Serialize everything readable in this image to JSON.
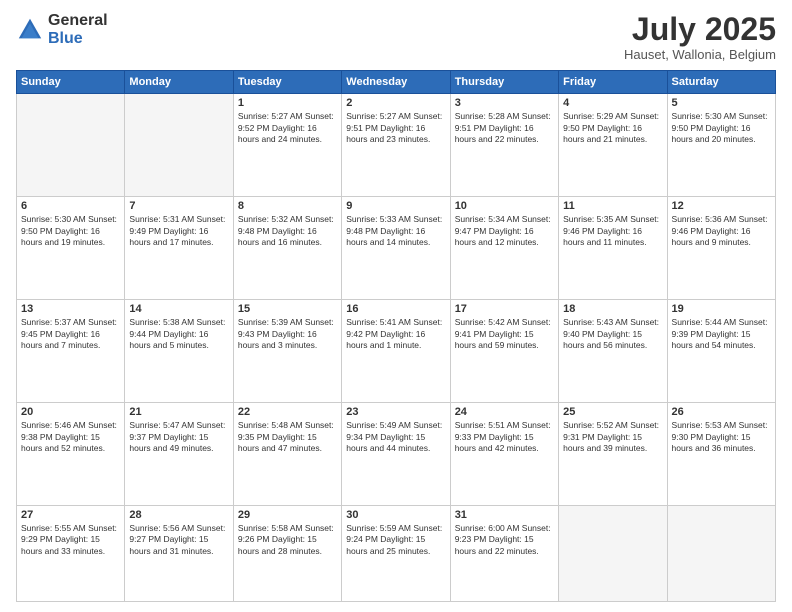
{
  "header": {
    "logo_general": "General",
    "logo_blue": "Blue",
    "month_title": "July 2025",
    "subtitle": "Hauset, Wallonia, Belgium"
  },
  "days_of_week": [
    "Sunday",
    "Monday",
    "Tuesday",
    "Wednesday",
    "Thursday",
    "Friday",
    "Saturday"
  ],
  "weeks": [
    [
      {
        "day": "",
        "info": ""
      },
      {
        "day": "",
        "info": ""
      },
      {
        "day": "1",
        "info": "Sunrise: 5:27 AM\nSunset: 9:52 PM\nDaylight: 16 hours and 24 minutes."
      },
      {
        "day": "2",
        "info": "Sunrise: 5:27 AM\nSunset: 9:51 PM\nDaylight: 16 hours and 23 minutes."
      },
      {
        "day": "3",
        "info": "Sunrise: 5:28 AM\nSunset: 9:51 PM\nDaylight: 16 hours and 22 minutes."
      },
      {
        "day": "4",
        "info": "Sunrise: 5:29 AM\nSunset: 9:50 PM\nDaylight: 16 hours and 21 minutes."
      },
      {
        "day": "5",
        "info": "Sunrise: 5:30 AM\nSunset: 9:50 PM\nDaylight: 16 hours and 20 minutes."
      }
    ],
    [
      {
        "day": "6",
        "info": "Sunrise: 5:30 AM\nSunset: 9:50 PM\nDaylight: 16 hours and 19 minutes."
      },
      {
        "day": "7",
        "info": "Sunrise: 5:31 AM\nSunset: 9:49 PM\nDaylight: 16 hours and 17 minutes."
      },
      {
        "day": "8",
        "info": "Sunrise: 5:32 AM\nSunset: 9:48 PM\nDaylight: 16 hours and 16 minutes."
      },
      {
        "day": "9",
        "info": "Sunrise: 5:33 AM\nSunset: 9:48 PM\nDaylight: 16 hours and 14 minutes."
      },
      {
        "day": "10",
        "info": "Sunrise: 5:34 AM\nSunset: 9:47 PM\nDaylight: 16 hours and 12 minutes."
      },
      {
        "day": "11",
        "info": "Sunrise: 5:35 AM\nSunset: 9:46 PM\nDaylight: 16 hours and 11 minutes."
      },
      {
        "day": "12",
        "info": "Sunrise: 5:36 AM\nSunset: 9:46 PM\nDaylight: 16 hours and 9 minutes."
      }
    ],
    [
      {
        "day": "13",
        "info": "Sunrise: 5:37 AM\nSunset: 9:45 PM\nDaylight: 16 hours and 7 minutes."
      },
      {
        "day": "14",
        "info": "Sunrise: 5:38 AM\nSunset: 9:44 PM\nDaylight: 16 hours and 5 minutes."
      },
      {
        "day": "15",
        "info": "Sunrise: 5:39 AM\nSunset: 9:43 PM\nDaylight: 16 hours and 3 minutes."
      },
      {
        "day": "16",
        "info": "Sunrise: 5:41 AM\nSunset: 9:42 PM\nDaylight: 16 hours and 1 minute."
      },
      {
        "day": "17",
        "info": "Sunrise: 5:42 AM\nSunset: 9:41 PM\nDaylight: 15 hours and 59 minutes."
      },
      {
        "day": "18",
        "info": "Sunrise: 5:43 AM\nSunset: 9:40 PM\nDaylight: 15 hours and 56 minutes."
      },
      {
        "day": "19",
        "info": "Sunrise: 5:44 AM\nSunset: 9:39 PM\nDaylight: 15 hours and 54 minutes."
      }
    ],
    [
      {
        "day": "20",
        "info": "Sunrise: 5:46 AM\nSunset: 9:38 PM\nDaylight: 15 hours and 52 minutes."
      },
      {
        "day": "21",
        "info": "Sunrise: 5:47 AM\nSunset: 9:37 PM\nDaylight: 15 hours and 49 minutes."
      },
      {
        "day": "22",
        "info": "Sunrise: 5:48 AM\nSunset: 9:35 PM\nDaylight: 15 hours and 47 minutes."
      },
      {
        "day": "23",
        "info": "Sunrise: 5:49 AM\nSunset: 9:34 PM\nDaylight: 15 hours and 44 minutes."
      },
      {
        "day": "24",
        "info": "Sunrise: 5:51 AM\nSunset: 9:33 PM\nDaylight: 15 hours and 42 minutes."
      },
      {
        "day": "25",
        "info": "Sunrise: 5:52 AM\nSunset: 9:31 PM\nDaylight: 15 hours and 39 minutes."
      },
      {
        "day": "26",
        "info": "Sunrise: 5:53 AM\nSunset: 9:30 PM\nDaylight: 15 hours and 36 minutes."
      }
    ],
    [
      {
        "day": "27",
        "info": "Sunrise: 5:55 AM\nSunset: 9:29 PM\nDaylight: 15 hours and 33 minutes."
      },
      {
        "day": "28",
        "info": "Sunrise: 5:56 AM\nSunset: 9:27 PM\nDaylight: 15 hours and 31 minutes."
      },
      {
        "day": "29",
        "info": "Sunrise: 5:58 AM\nSunset: 9:26 PM\nDaylight: 15 hours and 28 minutes."
      },
      {
        "day": "30",
        "info": "Sunrise: 5:59 AM\nSunset: 9:24 PM\nDaylight: 15 hours and 25 minutes."
      },
      {
        "day": "31",
        "info": "Sunrise: 6:00 AM\nSunset: 9:23 PM\nDaylight: 15 hours and 22 minutes."
      },
      {
        "day": "",
        "info": ""
      },
      {
        "day": "",
        "info": ""
      }
    ]
  ]
}
